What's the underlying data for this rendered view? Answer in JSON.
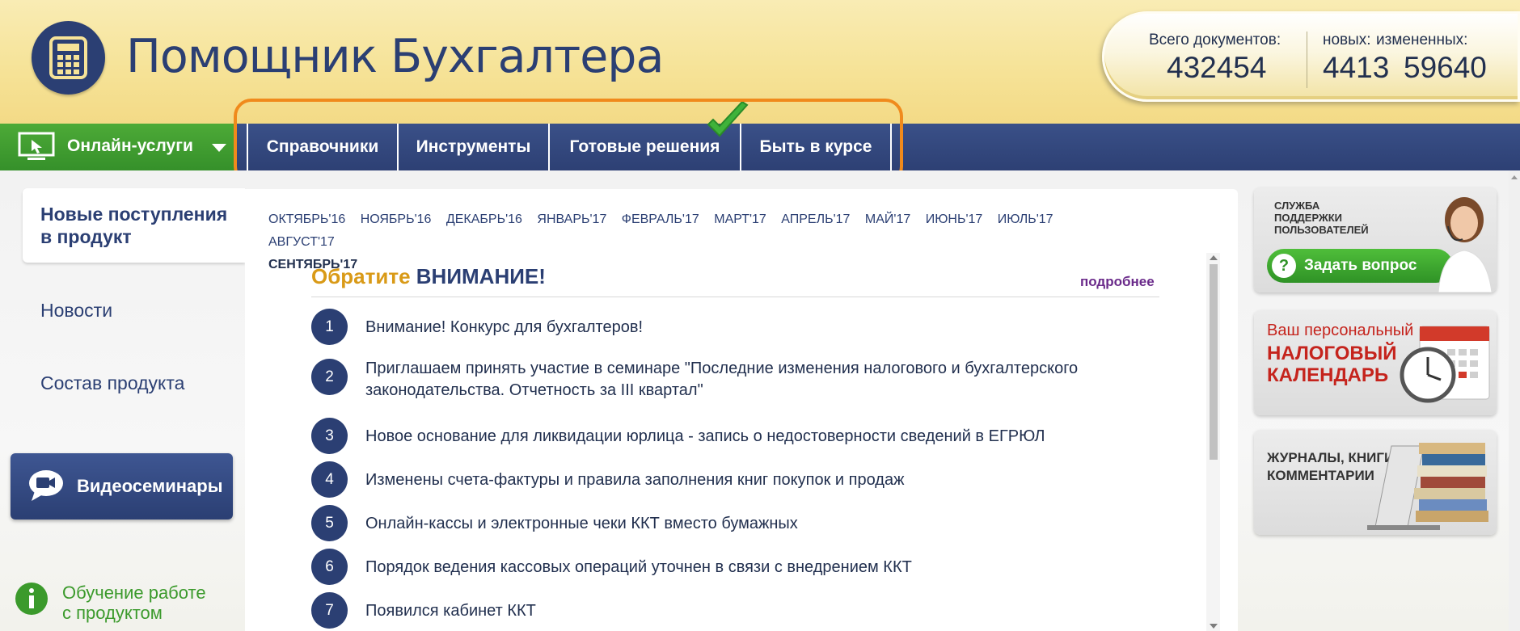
{
  "header": {
    "title": "Помощник Бухгалтера",
    "logo_icon": "calculator-icon",
    "stats": {
      "total_label": "Всего документов:",
      "total_value": "432454",
      "new_label": "новых:",
      "new_value": "4413",
      "changed_label": "измененных:",
      "changed_value": "59640"
    }
  },
  "nav": {
    "online_label": "Онлайн-услуги",
    "items": [
      {
        "label": "Справочники"
      },
      {
        "label": "Инструменты"
      },
      {
        "label": "Готовые решения"
      },
      {
        "label": "Быть в курсе"
      }
    ]
  },
  "sidebar": {
    "active_label": "Новые поступления в продукт",
    "active_line1": "Новые поступления",
    "active_line2": "в продукт",
    "news_label": "Новости",
    "composition_label": "Состав продукта",
    "video_label": "Видеосеминары",
    "learn_line1": "Обучение работе",
    "learn_line2": "с продуктом"
  },
  "months": [
    "ОКТЯБРЬ'16",
    "НОЯБРЬ'16",
    "ДЕКАБРЬ'16",
    "ЯНВАРЬ'17",
    "ФЕВРАЛЬ'17",
    "МАРТ'17",
    "АПРЕЛЬ'17",
    "МАЙ'17",
    "ИЮНЬ'17",
    "ИЮЛЬ'17",
    "АВГУСТ'17",
    "СЕНТЯБРЬ'17"
  ],
  "active_month": "СЕНТЯБРЬ'17",
  "attention": {
    "title_part1": "Обратите",
    "title_part2": "ВНИМАНИЕ!",
    "more_label": "подробнее",
    "items": [
      {
        "num": "1",
        "text": "Внимание! Конкурс для бухгалтеров!"
      },
      {
        "num": "2",
        "text": "Приглашаем принять участие в семинаре \"Последние изменения налогового и бухгалтерского законодательства. Отчетность за III квартал\""
      },
      {
        "num": "3",
        "text": "Новое основание для ликвидации юрлица - запись о недостоверности сведений в ЕГРЮЛ"
      },
      {
        "num": "4",
        "text": "Изменены счета-фактуры и правила заполнения книг покупок и продаж"
      },
      {
        "num": "5",
        "text": "Онлайн-кассы и электронные чеки ККТ вместо бумажных"
      },
      {
        "num": "6",
        "text": "Порядок ведения кассовых операций уточнен в связи с внедрением ККТ"
      },
      {
        "num": "7",
        "text": "Появился кабинет ККТ"
      }
    ]
  },
  "banners": {
    "support_line1": "СЛУЖБА",
    "support_line2": "ПОДДЕРЖКИ",
    "support_line3": "ПОЛЬЗОВАТЕЛЕЙ",
    "ask_label": "Задать вопрос",
    "tax_line1": "Ваш персональный",
    "tax_line2": "НАЛОГОВЫЙ",
    "tax_line3": "КАЛЕНДАРЬ",
    "journals_line1": "ЖУРНАЛЫ, КНИГИ,",
    "journals_line2": "КОММЕНТАРИИ"
  },
  "colors": {
    "brand_blue": "#2b3f73",
    "brand_green": "#3b9a2c",
    "highlight_orange": "#f08a1c",
    "attention_gold": "#d99a17"
  }
}
